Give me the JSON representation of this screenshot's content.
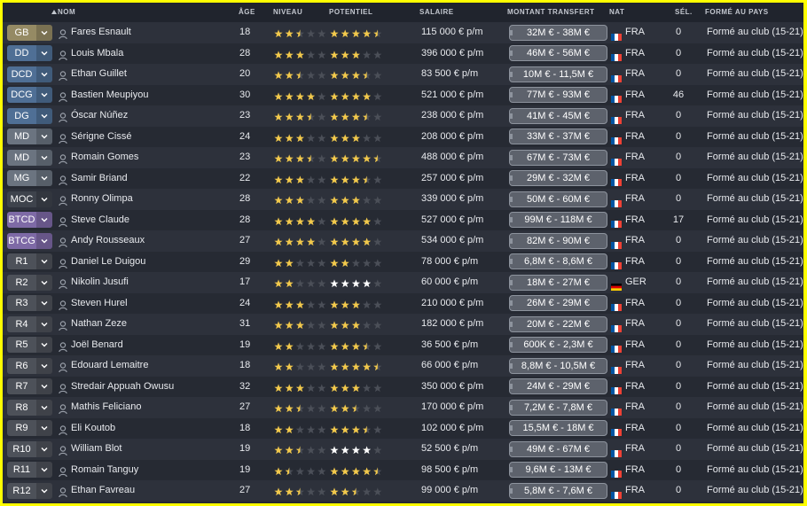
{
  "columns": {
    "name": "NOM",
    "age": "ÂGE",
    "level": "NIVEAU",
    "potential": "POTENTIEL",
    "salary": "SALAIRE",
    "transfer": "MONTANT TRANSFERT",
    "nat": "NAT",
    "sel": "SÉL.",
    "trained": "FORMÉ AU PAYS"
  },
  "sort_indicator": "ascending-arrow-icon on NOM column",
  "colors": {
    "pos_goalkeeper": "#958a64",
    "pos_defender": "#4f6f95",
    "pos_midfielder": "#6b7480",
    "pos_attacker": "#7e6aa6",
    "pos_reserve": "#4d5159",
    "star": "#f2c94c",
    "star_empty": "#4b4f58",
    "star_potential_max": "#ffffff"
  },
  "players": [
    {
      "pos": "GB",
      "posColor": "#958a64",
      "name": "Fares Esnault",
      "age": "18",
      "level": 2.5,
      "potential": 4.5,
      "salary": "115 000 € p/m",
      "transfer": "32M € - 38M €",
      "nat": "FRA",
      "flag": "fr",
      "sel": "0",
      "trained": "Formé au club (15-21)"
    },
    {
      "pos": "DD",
      "posColor": "#4f6f95",
      "name": "Louis Mbala",
      "age": "28",
      "level": 3,
      "potential": 3,
      "salary": "396 000 € p/m",
      "transfer": "46M € - 56M €",
      "nat": "FRA",
      "flag": "fr",
      "sel": "0",
      "trained": "Formé au club (15-21)"
    },
    {
      "pos": "DCD",
      "posColor": "#4f6f95",
      "name": "Ethan Guillet",
      "age": "20",
      "level": 2.5,
      "potential": 3.5,
      "salary": "83 500 € p/m",
      "transfer": "10M € - 11,5M €",
      "nat": "FRA",
      "flag": "fr",
      "sel": "0",
      "trained": "Formé au club (15-21)"
    },
    {
      "pos": "DCG",
      "posColor": "#4f6f95",
      "name": "Bastien Meupiyou",
      "age": "30",
      "level": 4,
      "potential": 4,
      "salary": "521 000 € p/m",
      "transfer": "77M € - 93M €",
      "nat": "FRA",
      "flag": "fr",
      "sel": "46",
      "trained": "Formé au club (15-21)"
    },
    {
      "pos": "DG",
      "posColor": "#4f6f95",
      "name": "Óscar Núñez",
      "age": "23",
      "level": 3.5,
      "potential": 3.5,
      "salary": "238 000 € p/m",
      "transfer": "41M € - 45M €",
      "nat": "FRA",
      "flag": "fr",
      "sel": "0",
      "trained": "Formé au club (15-21)"
    },
    {
      "pos": "MD",
      "posColor": "#6b7480",
      "name": "Sérigne Cissé",
      "age": "24",
      "level": 3,
      "potential": 3,
      "salary": "208 000 € p/m",
      "transfer": "33M € - 37M €",
      "nat": "FRA",
      "flag": "fr",
      "sel": "0",
      "trained": "Formé au club (15-21)"
    },
    {
      "pos": "MD",
      "posColor": "#6b7480",
      "name": "Romain Gomes",
      "age": "23",
      "level": 3.5,
      "potential": 4.5,
      "salary": "488 000 € p/m",
      "transfer": "67M € - 73M €",
      "nat": "FRA",
      "flag": "fr",
      "sel": "0",
      "trained": "Formé au club (15-21)"
    },
    {
      "pos": "MG",
      "posColor": "#6b7480",
      "name": "Samir Briand",
      "age": "22",
      "level": 3,
      "potential": 3.5,
      "salary": "257 000 € p/m",
      "transfer": "29M € - 32M €",
      "nat": "FRA",
      "flag": "fr",
      "sel": "0",
      "trained": "Formé au club (15-21)"
    },
    {
      "pos": "MOC",
      "posColor": "#3e434c",
      "name": "Ronny Olimpa",
      "age": "28",
      "level": 3,
      "potential": 3,
      "salary": "339 000 € p/m",
      "transfer": "50M € - 60M €",
      "nat": "FRA",
      "flag": "fr",
      "sel": "0",
      "trained": "Formé au club (15-21)"
    },
    {
      "pos": "BTCD",
      "posColor": "#7e6aa6",
      "name": "Steve Claude",
      "age": "28",
      "level": 4,
      "potential": 4,
      "salary": "527 000 € p/m",
      "transfer": "99M € - 118M €",
      "nat": "FRA",
      "flag": "fr",
      "sel": "17",
      "trained": "Formé au club (15-21)"
    },
    {
      "pos": "BTCG",
      "posColor": "#7e6aa6",
      "name": "Andy Rousseaux",
      "age": "27",
      "level": 4,
      "potential": 4,
      "salary": "534 000 € p/m",
      "transfer": "82M € - 90M €",
      "nat": "FRA",
      "flag": "fr",
      "sel": "0",
      "trained": "Formé au club (15-21)"
    },
    {
      "pos": "R1",
      "posColor": "#4d5159",
      "name": "Daniel Le Duigou",
      "age": "29",
      "level": 2,
      "potential": 2,
      "salary": "78 000 € p/m",
      "transfer": "6,8M € - 8,6M €",
      "nat": "FRA",
      "flag": "fr",
      "sel": "0",
      "trained": "Formé au club (15-21)"
    },
    {
      "pos": "R2",
      "posColor": "#4d5159",
      "name": "Nikolin Jusufi",
      "age": "17",
      "level": 2,
      "potential": 4,
      "potMax": true,
      "salary": "60 000 € p/m",
      "transfer": "18M € - 27M €",
      "nat": "GER",
      "flag": "de",
      "sel": "0",
      "trained": "Formé au club (15-21)"
    },
    {
      "pos": "R3",
      "posColor": "#4d5159",
      "name": "Steven Hurel",
      "age": "24",
      "level": 3,
      "potential": 3,
      "salary": "210 000 € p/m",
      "transfer": "26M € - 29M €",
      "nat": "FRA",
      "flag": "fr",
      "sel": "0",
      "trained": "Formé au club (15-21)"
    },
    {
      "pos": "R4",
      "posColor": "#4d5159",
      "name": "Nathan Zeze",
      "age": "31",
      "level": 3,
      "potential": 3,
      "salary": "182 000 € p/m",
      "transfer": "20M € - 22M €",
      "nat": "FRA",
      "flag": "fr",
      "sel": "0",
      "trained": "Formé au club (15-21)"
    },
    {
      "pos": "R5",
      "posColor": "#4d5159",
      "name": "Joël Benard",
      "age": "19",
      "level": 2,
      "potential": 3.5,
      "salary": "36 500 € p/m",
      "transfer": "600K € - 2,3M €",
      "nat": "FRA",
      "flag": "fr",
      "sel": "0",
      "trained": "Formé au club (15-21)"
    },
    {
      "pos": "R6",
      "posColor": "#4d5159",
      "name": "Edouard Lemaitre",
      "age": "18",
      "level": 2,
      "potential": 4.5,
      "salary": "66 000 € p/m",
      "transfer": "8,8M € - 10,5M €",
      "nat": "FRA",
      "flag": "fr",
      "sel": "0",
      "trained": "Formé au club (15-21)"
    },
    {
      "pos": "R7",
      "posColor": "#4d5159",
      "name": "Stredair Appuah Owusu",
      "age": "32",
      "level": 3,
      "potential": 3,
      "salary": "350 000 € p/m",
      "transfer": "24M € - 29M €",
      "nat": "FRA",
      "flag": "fr",
      "sel": "0",
      "trained": "Formé au club (15-21)"
    },
    {
      "pos": "R8",
      "posColor": "#4d5159",
      "name": "Mathis Feliciano",
      "age": "27",
      "level": 2.5,
      "potential": 2.5,
      "salary": "170 000 € p/m",
      "transfer": "7,2M € - 7,8M €",
      "nat": "FRA",
      "flag": "fr",
      "sel": "0",
      "trained": "Formé au club (15-21)"
    },
    {
      "pos": "R9",
      "posColor": "#4d5159",
      "name": "Eli Koutob",
      "age": "18",
      "level": 2,
      "potential": 3.5,
      "salary": "102 000 € p/m",
      "transfer": "15,5M € - 18M €",
      "nat": "FRA",
      "flag": "fr",
      "sel": "0",
      "trained": "Formé au club (15-21)"
    },
    {
      "pos": "R10",
      "posColor": "#4d5159",
      "name": "William Blot",
      "age": "19",
      "level": 2.5,
      "potential": 4,
      "potMax": true,
      "salary": "52 500 € p/m",
      "transfer": "49M € - 67M €",
      "nat": "FRA",
      "flag": "fr",
      "sel": "0",
      "trained": "Formé au club (15-21)"
    },
    {
      "pos": "R11",
      "posColor": "#4d5159",
      "name": "Romain Tanguy",
      "age": "19",
      "level": 1.5,
      "potential": 4.5,
      "salary": "98 500 € p/m",
      "transfer": "9,6M € - 13M €",
      "nat": "FRA",
      "flag": "fr",
      "sel": "0",
      "trained": "Formé au club (15-21)"
    },
    {
      "pos": "R12",
      "posColor": "#4d5159",
      "name": "Ethan Favreau",
      "age": "27",
      "level": 2.5,
      "potential": 2.5,
      "salary": "99 000 € p/m",
      "transfer": "5,8M € - 7,6M €",
      "nat": "FRA",
      "flag": "fr",
      "sel": "0",
      "trained": "Formé au club (15-21)"
    }
  ]
}
